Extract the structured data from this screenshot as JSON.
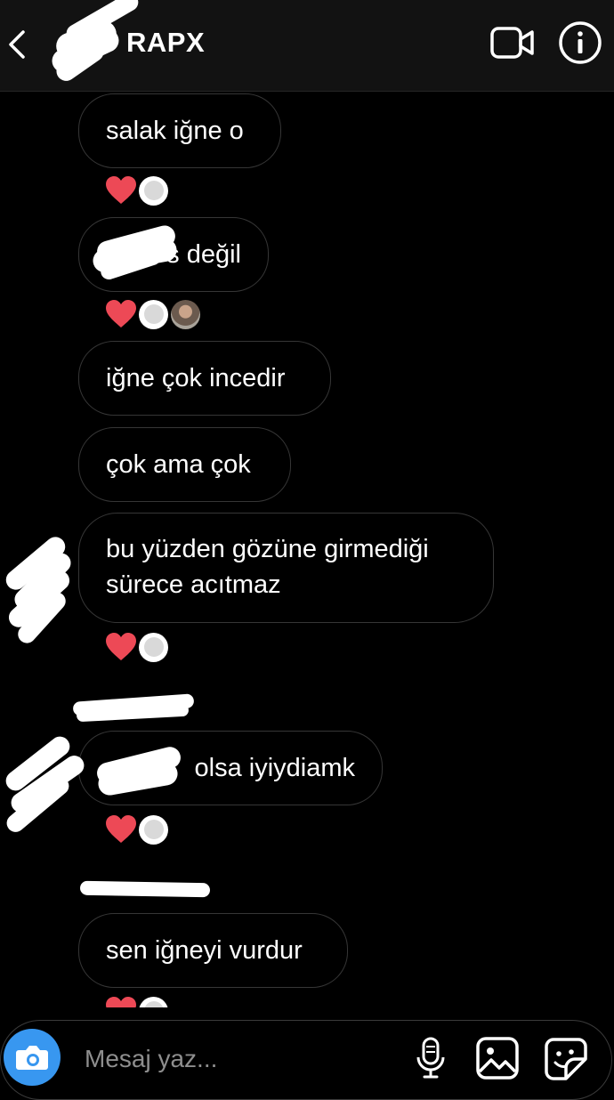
{
  "header": {
    "title": "RAPX"
  },
  "messages": [
    {
      "text": "salak iğne o",
      "reactions": [
        "heart",
        "avatar"
      ]
    },
    {
      "text": "s değil",
      "reactions": [
        "heart",
        "avatar",
        "avatar-photo"
      ]
    },
    {
      "text": "iğne çok incedir",
      "reactions": []
    },
    {
      "text": "çok ama çok",
      "reactions": []
    },
    {
      "text": "bu yüzden gözüne girmediği sürece acıtmaz",
      "reactions": [
        "heart",
        "avatar"
      ]
    },
    {
      "text": "olsa iyiydiamk",
      "reactions": [
        "heart",
        "avatar"
      ]
    },
    {
      "text": "sen iğneyi vurdur",
      "reactions": [
        "heart",
        "avatar"
      ]
    }
  ],
  "composer": {
    "placeholder": "Mesaj yaz..."
  },
  "icons": {
    "back": "chevron-left-icon",
    "video": "video-camera-icon",
    "info": "info-icon",
    "camera": "camera-icon",
    "mic": "microphone-icon",
    "gallery": "image-icon",
    "sticker": "sticker-icon"
  },
  "colors": {
    "background": "#000000",
    "header": "#121212",
    "bubble_border": "#363636",
    "heart": "#ed4956",
    "camera_button": "#3897f0",
    "placeholder": "#8e8e8e"
  }
}
